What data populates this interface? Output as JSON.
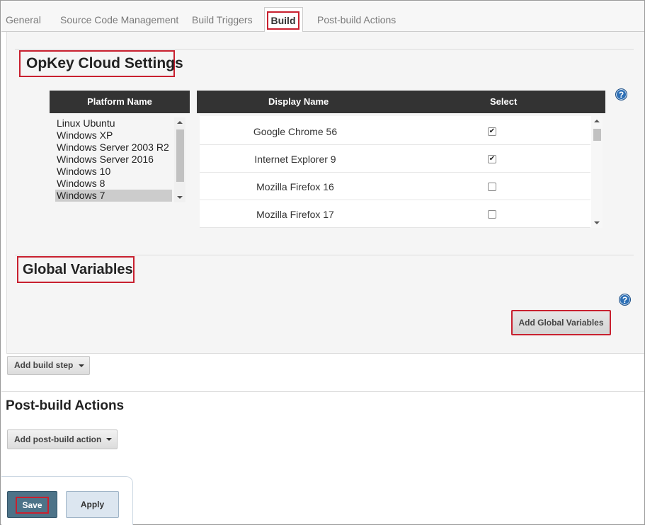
{
  "tabs": [
    {
      "label": "General"
    },
    {
      "label": "Source Code Management"
    },
    {
      "label": "Build Triggers"
    },
    {
      "label": "Build",
      "active": true
    },
    {
      "label": "Post-build Actions"
    }
  ],
  "opkey": {
    "heading": "OpKey Cloud Settings",
    "help_icon": "?",
    "platform_header": "Platform Name",
    "display_header": "Display Name",
    "select_header": "Select",
    "platforms": [
      "Linux Ubuntu",
      "Windows XP",
      "Windows Server 2003 R2",
      "Windows Server 2016",
      "Windows 10",
      "Windows 8",
      "Windows 7"
    ],
    "selected_platform": "Windows 7",
    "browsers": [
      {
        "name": "Google Chrome 56",
        "checked": true
      },
      {
        "name": "Internet Explorer 9",
        "checked": true
      },
      {
        "name": "Mozilla Firefox 16",
        "checked": false
      },
      {
        "name": "Mozilla Firefox 17",
        "checked": false
      }
    ]
  },
  "global": {
    "heading": "Global Variables",
    "help_icon": "?",
    "add_button": "Add Global Variables"
  },
  "build": {
    "add_step": "Add build step"
  },
  "post_build": {
    "heading": "Post-build Actions",
    "add_action": "Add post-build action"
  },
  "footer": {
    "save": "Save",
    "apply": "Apply"
  },
  "colors": {
    "highlight": "#c8202f",
    "header_bg": "#333333",
    "save_bg": "#4d7388",
    "apply_bg": "#dce6f0",
    "help_icon": "#2d6fb5"
  }
}
